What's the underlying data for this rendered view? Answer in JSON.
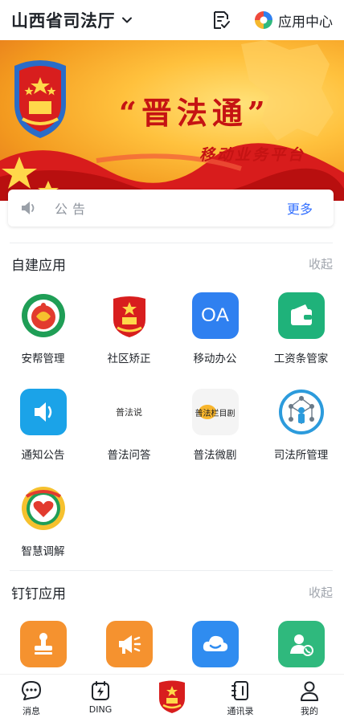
{
  "header": {
    "org_title": "山西省司法厅",
    "app_center_label": "应用中心"
  },
  "banner": {
    "title": "“晋法通”",
    "subtitle": "移动业务平台"
  },
  "notice": {
    "label": "公告",
    "more": "更多"
  },
  "self_apps": {
    "title": "自建应用",
    "collapse": "收起",
    "items": [
      {
        "label": "安帮管理",
        "icon": "anbang-logo-icon"
      },
      {
        "label": "社区矫正",
        "icon": "national-emblem-icon"
      },
      {
        "label": "移动办公",
        "icon": "oa-icon",
        "icon_text": "OA",
        "color": "#2f80f0"
      },
      {
        "label": "工资条管家",
        "icon": "wallet-icon",
        "color": "#1fb27a"
      },
      {
        "label": "通知公告",
        "icon": "speaker-icon",
        "color": "#1ba3e8"
      },
      {
        "label": "普法问答",
        "icon": "pufa-qa-logo-icon",
        "icon_text": "普法说"
      },
      {
        "label": "普法微剧",
        "icon": "pufa-drama-logo-icon",
        "icon_text": "普法栏目剧"
      },
      {
        "label": "司法所管理",
        "icon": "network-person-icon",
        "color": "#2c9bdc"
      },
      {
        "label": "智慧调解",
        "icon": "mediation-logo-icon"
      }
    ]
  },
  "dingtalk_apps": {
    "title": "钉钉应用",
    "collapse": "收起",
    "items": [
      {
        "label": "",
        "icon": "stamp-icon",
        "color": "#f5922f"
      },
      {
        "label": "",
        "icon": "megaphone-icon",
        "color": "#f5922f"
      },
      {
        "label": "",
        "icon": "cloud-disk-icon",
        "color": "#2f8cf0"
      },
      {
        "label": "",
        "icon": "contact-call-icon",
        "color": "#2fb97d"
      }
    ]
  },
  "tabbar": {
    "items": [
      {
        "label": "消息",
        "icon": "chat-icon"
      },
      {
        "label": "DING",
        "icon": "ding-icon"
      },
      {
        "label": "",
        "icon": "national-emblem-icon"
      },
      {
        "label": "通讯录",
        "icon": "contacts-icon"
      },
      {
        "label": "我的",
        "icon": "profile-icon"
      }
    ]
  },
  "colors": {
    "accent_blue": "#3370ff",
    "banner_red": "#c51313",
    "banner_gold": "#ffc13d"
  }
}
